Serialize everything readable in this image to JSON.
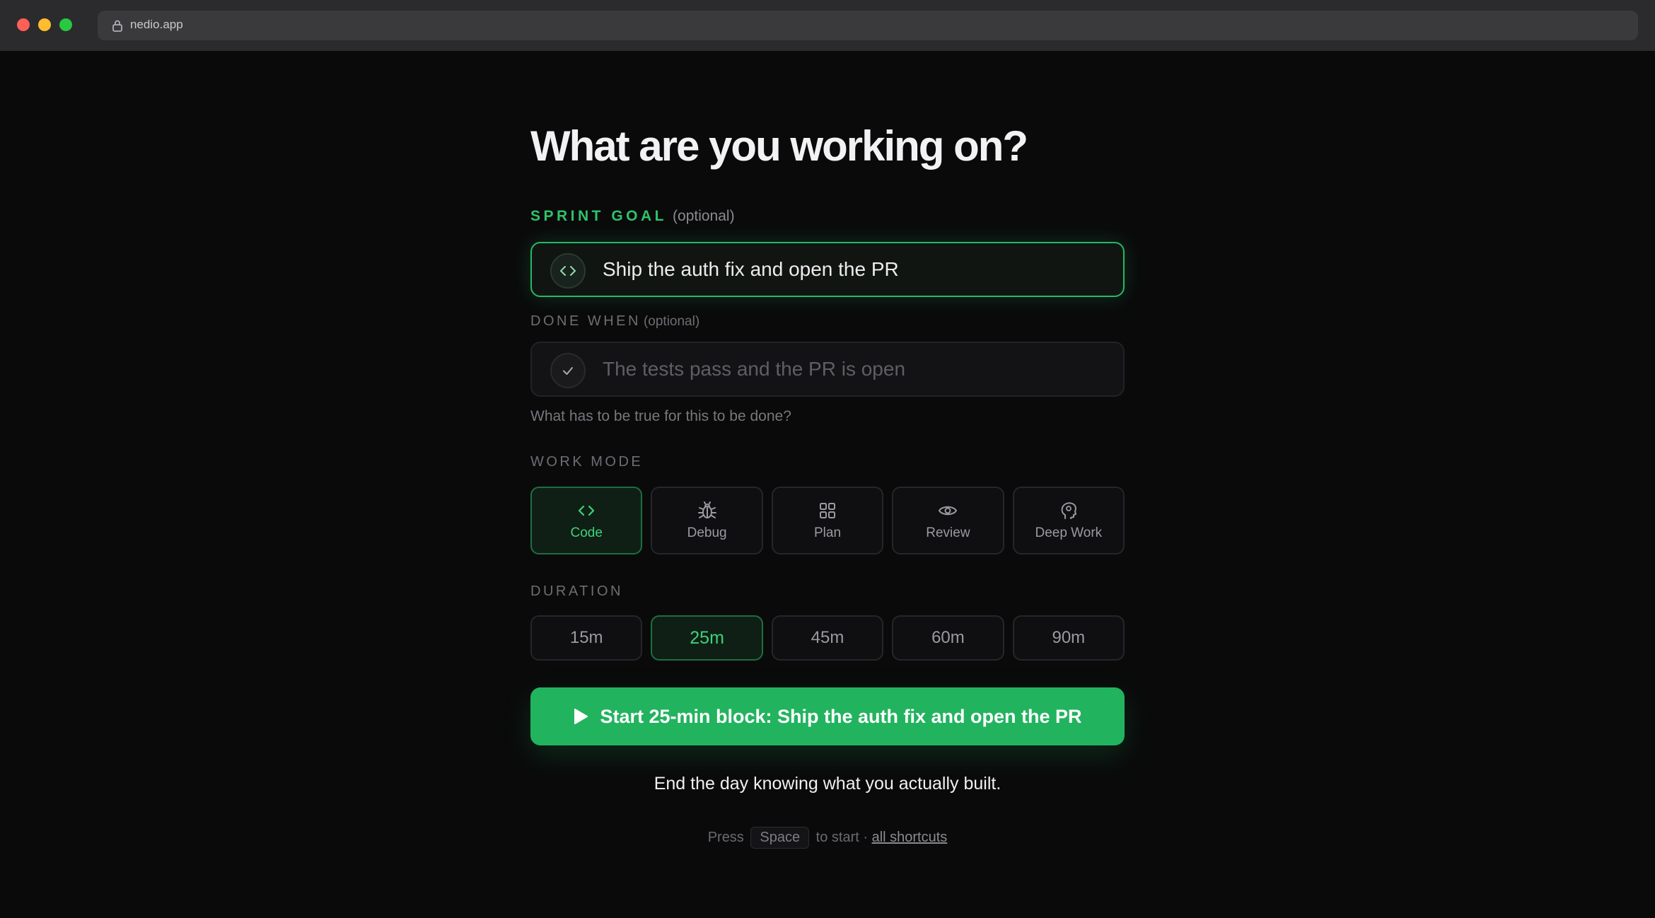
{
  "browser": {
    "url": "nedio.app"
  },
  "heading": "What are you working on?",
  "sprint_goal": {
    "label": "SPRINT GOAL",
    "optional": "(optional)",
    "value": "Ship the auth fix and open the PR",
    "icon": "code-icon"
  },
  "done_when": {
    "label": "DONE WHEN",
    "optional": "(optional)",
    "placeholder": "The tests pass and the PR is open",
    "icon": "check-icon",
    "helper": "What has to be true for this to be done?"
  },
  "work_mode": {
    "label": "WORK MODE",
    "selected": "Code",
    "options": [
      {
        "label": "Code",
        "icon": "code-icon"
      },
      {
        "label": "Debug",
        "icon": "bug-icon"
      },
      {
        "label": "Plan",
        "icon": "grid-icon"
      },
      {
        "label": "Review",
        "icon": "eye-icon"
      },
      {
        "label": "Deep Work",
        "icon": "brain-icon"
      }
    ]
  },
  "duration": {
    "label": "DURATION",
    "selected": "25m",
    "options": [
      "15m",
      "25m",
      "45m",
      "60m",
      "90m"
    ]
  },
  "start_button": {
    "label": "Start 25-min block: Ship the auth fix and open the PR",
    "icon": "play-icon"
  },
  "tagline": "End the day knowing what you actually built.",
  "hint": {
    "press": "Press",
    "key": "Space",
    "to_start": "to start ·",
    "link": "all shortcuts"
  },
  "colors": {
    "accent": "#22b35f",
    "accent_text": "#3ed27a",
    "background": "#0a0a0b",
    "chrome": "#2b2b2d"
  }
}
